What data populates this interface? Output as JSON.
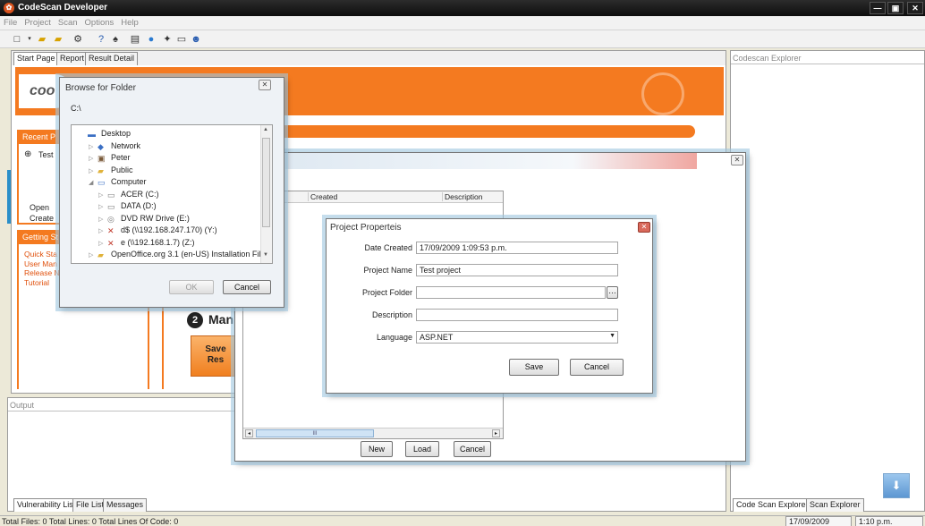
{
  "window": {
    "title": "CodeScan Developer"
  },
  "menu": [
    "File",
    "Project",
    "Scan",
    "Options",
    "Help"
  ],
  "main_tabs": [
    "Start Page",
    "Report",
    "Result Detail"
  ],
  "start_page": {
    "logo_text": "coo",
    "recent_header": "Recent P",
    "recent_item": "Test",
    "open_label": "Open",
    "create_label": "Create",
    "getting_started_header": "Getting St",
    "getting_links": [
      "Quick Sta",
      "User Man",
      "Release N",
      "Tutorial"
    ],
    "manage_text": "Man",
    "step_number": "2",
    "save_button_line1": "Save",
    "save_button_line2": "Res"
  },
  "explorer": {
    "title": "Codescan Explorer",
    "bottom_tabs": [
      "Code Scan Explorer",
      "Scan Explorer"
    ]
  },
  "output": {
    "title": "Output",
    "tabs": [
      "Vulnerability List",
      "File List",
      "Messages"
    ]
  },
  "browse_dialog": {
    "title": "Browse for Folder",
    "path": "C:\\",
    "tree": [
      {
        "label": "Desktop",
        "icon": "desktop-icon",
        "level": 0
      },
      {
        "label": "Network",
        "icon": "network-icon",
        "level": 1
      },
      {
        "label": "Peter",
        "icon": "user-icon",
        "level": 1
      },
      {
        "label": "Public",
        "icon": "folder-icon",
        "level": 1
      },
      {
        "label": "Computer",
        "icon": "computer-icon",
        "level": 1
      },
      {
        "label": "ACER (C:)",
        "icon": "drive-icon",
        "level": 2
      },
      {
        "label": "DATA (D:)",
        "icon": "drive-icon",
        "level": 2
      },
      {
        "label": "DVD RW Drive (E:)",
        "icon": "dvd-icon",
        "level": 2
      },
      {
        "label": "d$ (\\\\192.168.247.170) (Y:)",
        "icon": "network-drive-icon",
        "level": 2
      },
      {
        "label": "e (\\\\192.168.1.7) (Z:)",
        "icon": "network-drive-icon",
        "level": 2
      },
      {
        "label": "OpenOffice.org 3.1 (en-US) Installation Files",
        "icon": "folder-icon",
        "level": 1
      }
    ],
    "ok_label": "OK",
    "cancel_label": "Cancel"
  },
  "open_project_dialog": {
    "columns": [
      "e",
      "Created",
      "Description"
    ],
    "scroll_thumb": "III",
    "new_label": "New",
    "load_label": "Load",
    "cancel_label": "Cancel"
  },
  "project_properties": {
    "title": "Project Properteis",
    "date_created_label": "Date Created",
    "date_created_value": "17/09/2009 1:09:53 p.m.",
    "project_name_label": "Project Name",
    "project_name_value": "Test project",
    "project_folder_label": "Project Folder",
    "project_folder_value": "",
    "description_label": "Description",
    "description_value": "",
    "language_label": "Language",
    "language_value": "ASP.NET",
    "save_label": "Save",
    "cancel_label": "Cancel"
  },
  "status": {
    "summary": "Total Files: 0  Total Lines: 0  Total Lines Of Code: 0",
    "date": "17/09/2009",
    "time": "1:10 p.m."
  },
  "colors": {
    "accent": "#f47a20",
    "titlebar": "#111111",
    "dialog_glow": "#a0c8e1"
  }
}
